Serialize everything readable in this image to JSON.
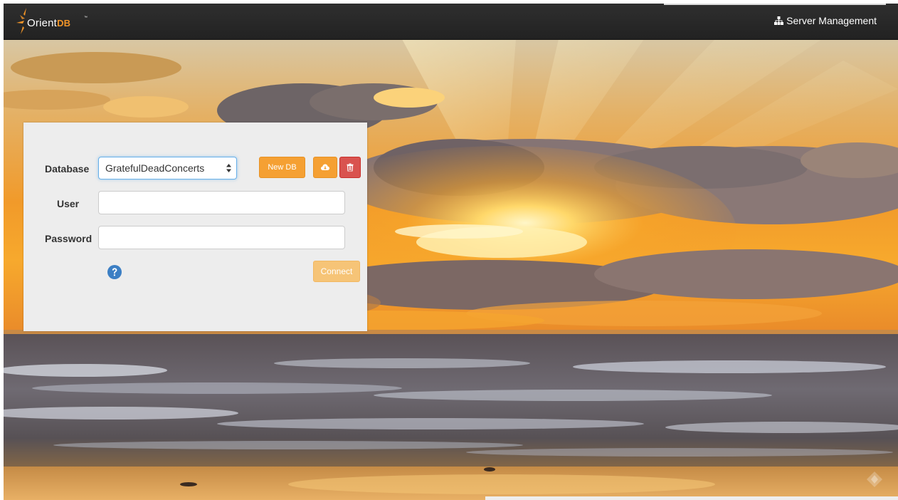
{
  "app": {
    "brand_main": "Orient",
    "brand_accent": "DB",
    "brand_tm": "™",
    "accent_color": "#f29528"
  },
  "navbar": {
    "server_management_label": "Server Management",
    "server_management_icon": "sitemap-icon"
  },
  "login": {
    "database_label": "Database",
    "database_selected": "GratefulDeadConcerts",
    "user_label": "User",
    "user_value": "",
    "password_label": "Password",
    "password_value": "",
    "new_db_label": "New DB",
    "import_icon": "cloud-download-icon",
    "delete_icon": "trash-icon",
    "help_icon": "question-circle-icon",
    "connect_label": "Connect"
  },
  "colors": {
    "navbar_bg": "#262626",
    "orange_button": "#f5a033",
    "danger_button": "#d9534f",
    "connect_disabled": "#f6c477",
    "help_blue": "#3c7fc4",
    "panel_bg": "#ededed"
  }
}
